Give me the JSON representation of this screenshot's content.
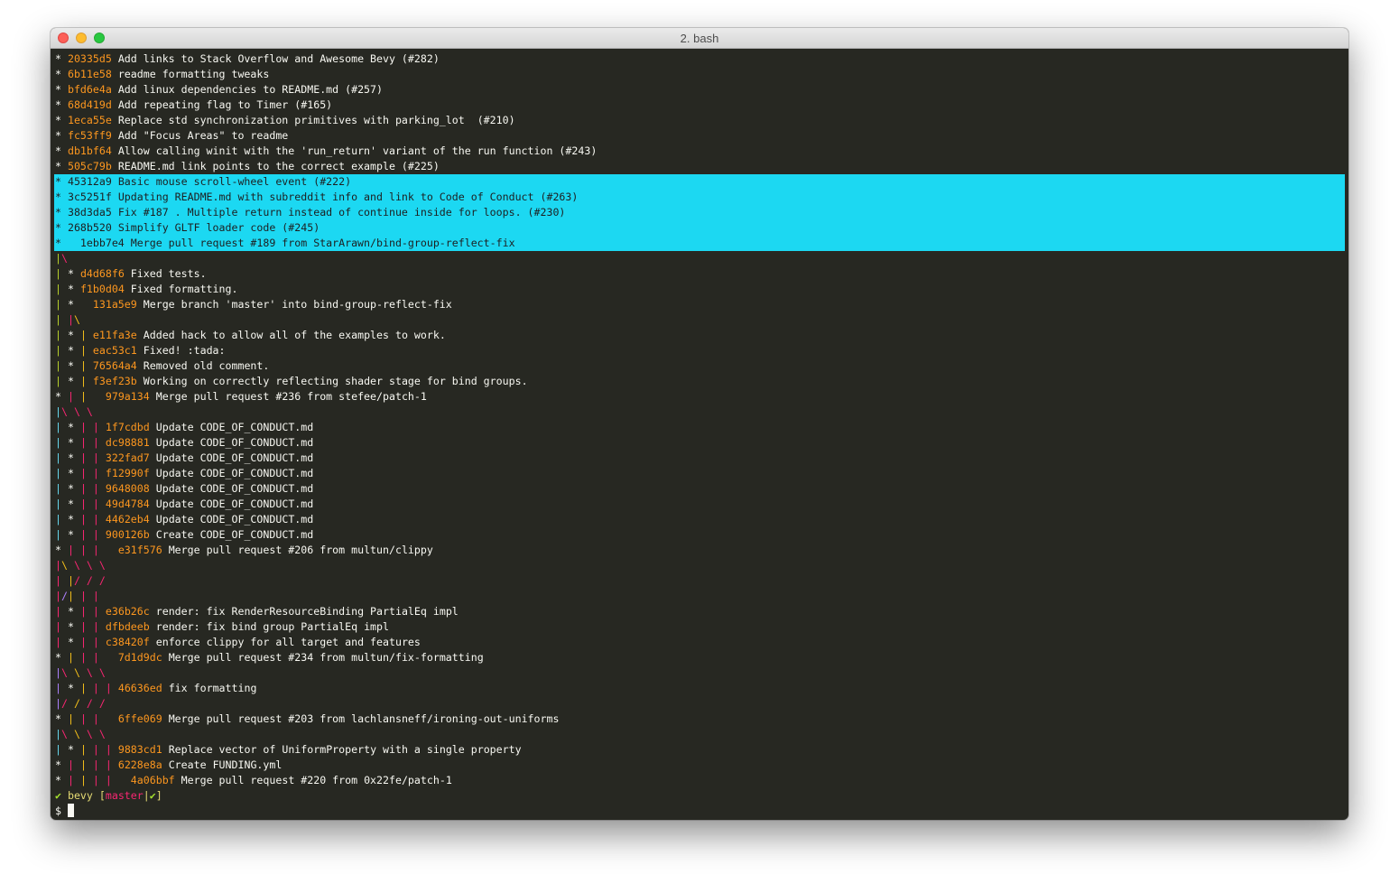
{
  "window": {
    "title": "2. bash"
  },
  "colors": {
    "background": "#272822",
    "selection": "#1cd8f2",
    "hash": "#fd971f",
    "graph_green": "#b8d12a",
    "graph_pink": "#f92672",
    "graph_yellow": "#f4bf1a",
    "graph_purple": "#ae81ff",
    "graph_cyan": "#66d9ef"
  },
  "log": [
    {
      "graph": [
        [
          "* ",
          ""
        ]
      ],
      "hash": "20335d5",
      "msg": "Add links to Stack Overflow and Awesome Bevy (#282)"
    },
    {
      "graph": [
        [
          "* ",
          ""
        ]
      ],
      "hash": "6b11e58",
      "msg": "readme formatting tweaks"
    },
    {
      "graph": [
        [
          "* ",
          ""
        ]
      ],
      "hash": "bfd6e4a",
      "msg": "Add linux dependencies to README.md (#257)"
    },
    {
      "graph": [
        [
          "* ",
          ""
        ]
      ],
      "hash": "68d419d",
      "msg": "Add repeating flag to Timer (#165)"
    },
    {
      "graph": [
        [
          "* ",
          ""
        ]
      ],
      "hash": "1eca55e",
      "msg": "Replace std synchronization primitives with parking_lot  (#210)"
    },
    {
      "graph": [
        [
          "* ",
          ""
        ]
      ],
      "hash": "fc53ff9",
      "msg": "Add \"Focus Areas\" to readme"
    },
    {
      "graph": [
        [
          "* ",
          ""
        ]
      ],
      "hash": "db1bf64",
      "msg": "Allow calling winit with the 'run_return' variant of the run function (#243)"
    },
    {
      "graph": [
        [
          "* ",
          ""
        ]
      ],
      "hash": "505c79b",
      "msg": "README.md link points to the correct example (#225)"
    },
    {
      "graph": [
        [
          "* ",
          ""
        ]
      ],
      "hash": "45312a9",
      "msg": "Basic mouse scroll-wheel event (#222)",
      "selected": true
    },
    {
      "graph": [
        [
          "* ",
          ""
        ]
      ],
      "hash": "3c5251f",
      "msg": "Updating README.md with subreddit info and link to Code of Conduct (#263)",
      "selected": true
    },
    {
      "graph": [
        [
          "* ",
          ""
        ]
      ],
      "hash": "38d3da5",
      "msg": "Fix #187 . Multiple return instead of continue inside for loops. (#230)",
      "selected": true
    },
    {
      "graph": [
        [
          "* ",
          ""
        ]
      ],
      "hash": "268b520",
      "msg": "Simplify GLTF loader code (#245)",
      "selected": true
    },
    {
      "graph": [
        [
          "*   ",
          ""
        ]
      ],
      "hash": "1ebb7e4",
      "msg": "Merge pull request #189 from StarArawn/bind-group-reflect-fix",
      "selected": true
    },
    {
      "graph": [
        [
          "|",
          "g1"
        ],
        [
          "\\",
          "g2"
        ]
      ],
      "hash": "",
      "msg": ""
    },
    {
      "graph": [
        [
          "| ",
          "g1"
        ],
        [
          "* ",
          ""
        ]
      ],
      "hash": "d4d68f6",
      "msg": "Fixed tests."
    },
    {
      "graph": [
        [
          "| ",
          "g1"
        ],
        [
          "* ",
          ""
        ]
      ],
      "hash": "f1b0d04",
      "msg": "Fixed formatting."
    },
    {
      "graph": [
        [
          "| ",
          "g1"
        ],
        [
          "*   ",
          ""
        ]
      ],
      "hash": "131a5e9",
      "msg": "Merge branch 'master' into bind-group-reflect-fix"
    },
    {
      "graph": [
        [
          "| ",
          "g1"
        ],
        [
          "|",
          "g2"
        ],
        [
          "\\",
          "g3"
        ]
      ],
      "hash": "",
      "msg": ""
    },
    {
      "graph": [
        [
          "| ",
          "g1"
        ],
        [
          "* ",
          ""
        ],
        [
          "| ",
          "g3"
        ]
      ],
      "hash": "e11fa3e",
      "msg": "Added hack to allow all of the examples to work."
    },
    {
      "graph": [
        [
          "| ",
          "g1"
        ],
        [
          "* ",
          ""
        ],
        [
          "| ",
          "g3"
        ]
      ],
      "hash": "eac53c1",
      "msg": "Fixed! :tada:"
    },
    {
      "graph": [
        [
          "| ",
          "g1"
        ],
        [
          "* ",
          ""
        ],
        [
          "| ",
          "g3"
        ]
      ],
      "hash": "76564a4",
      "msg": "Removed old comment."
    },
    {
      "graph": [
        [
          "| ",
          "g1"
        ],
        [
          "* ",
          ""
        ],
        [
          "| ",
          "g3"
        ]
      ],
      "hash": "f3ef23b",
      "msg": "Working on correctly reflecting shader stage for bind groups."
    },
    {
      "graph": [
        [
          "* ",
          ""
        ],
        [
          "| ",
          "g2"
        ],
        [
          "|   ",
          "g3"
        ]
      ],
      "hash": "979a134",
      "msg": "Merge pull request #236 from stefee/patch-1"
    },
    {
      "graph": [
        [
          "|",
          "g5"
        ],
        [
          "\\ ",
          "g2"
        ],
        [
          "\\ ",
          "g2"
        ],
        [
          "\\",
          "g2"
        ]
      ],
      "hash": "",
      "msg": ""
    },
    {
      "graph": [
        [
          "| ",
          "g5"
        ],
        [
          "* ",
          ""
        ],
        [
          "| ",
          "g2"
        ],
        [
          "| ",
          "g2"
        ]
      ],
      "hash": "1f7cdbd",
      "msg": "Update CODE_OF_CONDUCT.md"
    },
    {
      "graph": [
        [
          "| ",
          "g5"
        ],
        [
          "* ",
          ""
        ],
        [
          "| ",
          "g2"
        ],
        [
          "| ",
          "g2"
        ]
      ],
      "hash": "dc98881",
      "msg": "Update CODE_OF_CONDUCT.md"
    },
    {
      "graph": [
        [
          "| ",
          "g5"
        ],
        [
          "* ",
          ""
        ],
        [
          "| ",
          "g2"
        ],
        [
          "| ",
          "g2"
        ]
      ],
      "hash": "322fad7",
      "msg": "Update CODE_OF_CONDUCT.md"
    },
    {
      "graph": [
        [
          "| ",
          "g5"
        ],
        [
          "* ",
          ""
        ],
        [
          "| ",
          "g2"
        ],
        [
          "| ",
          "g2"
        ]
      ],
      "hash": "f12990f",
      "msg": "Update CODE_OF_CONDUCT.md"
    },
    {
      "graph": [
        [
          "| ",
          "g5"
        ],
        [
          "* ",
          ""
        ],
        [
          "| ",
          "g2"
        ],
        [
          "| ",
          "g2"
        ]
      ],
      "hash": "9648008",
      "msg": "Update CODE_OF_CONDUCT.md"
    },
    {
      "graph": [
        [
          "| ",
          "g5"
        ],
        [
          "* ",
          ""
        ],
        [
          "| ",
          "g2"
        ],
        [
          "| ",
          "g2"
        ]
      ],
      "hash": "49d4784",
      "msg": "Update CODE_OF_CONDUCT.md"
    },
    {
      "graph": [
        [
          "| ",
          "g5"
        ],
        [
          "* ",
          ""
        ],
        [
          "| ",
          "g2"
        ],
        [
          "| ",
          "g2"
        ]
      ],
      "hash": "4462eb4",
      "msg": "Update CODE_OF_CONDUCT.md"
    },
    {
      "graph": [
        [
          "| ",
          "g5"
        ],
        [
          "* ",
          ""
        ],
        [
          "| ",
          "g2"
        ],
        [
          "| ",
          "g2"
        ]
      ],
      "hash": "900126b",
      "msg": "Create CODE_OF_CONDUCT.md"
    },
    {
      "graph": [
        [
          "* ",
          ""
        ],
        [
          "| ",
          "g2"
        ],
        [
          "| ",
          "g2"
        ],
        [
          "|   ",
          "g2"
        ]
      ],
      "hash": "e31f576",
      "msg": "Merge pull request #206 from multun/clippy"
    },
    {
      "graph": [
        [
          "|",
          "g2"
        ],
        [
          "\\ ",
          "g3"
        ],
        [
          "\\ ",
          "g2"
        ],
        [
          "\\ ",
          "g2"
        ],
        [
          "\\",
          "g2"
        ]
      ],
      "hash": "",
      "msg": ""
    },
    {
      "graph": [
        [
          "| ",
          "g2"
        ],
        [
          "|",
          "g3"
        ],
        [
          "/ ",
          "g2"
        ],
        [
          "/ ",
          "g2"
        ],
        [
          "/",
          "g2"
        ]
      ],
      "hash": "",
      "msg": ""
    },
    {
      "graph": [
        [
          "|",
          "g2"
        ],
        [
          "/",
          "g4"
        ],
        [
          "| ",
          "g3"
        ],
        [
          "| ",
          "g2"
        ],
        [
          "|",
          "g2"
        ]
      ],
      "hash": "",
      "msg": ""
    },
    {
      "graph": [
        [
          "| ",
          "g2"
        ],
        [
          "* ",
          ""
        ],
        [
          "| ",
          "g2"
        ],
        [
          "| ",
          "g2"
        ]
      ],
      "hash": "e36b26c",
      "msg": "render: fix RenderResourceBinding PartialEq impl"
    },
    {
      "graph": [
        [
          "| ",
          "g2"
        ],
        [
          "* ",
          ""
        ],
        [
          "| ",
          "g2"
        ],
        [
          "| ",
          "g2"
        ]
      ],
      "hash": "dfbdeeb",
      "msg": "render: fix bind group PartialEq impl"
    },
    {
      "graph": [
        [
          "| ",
          "g2"
        ],
        [
          "* ",
          ""
        ],
        [
          "| ",
          "g2"
        ],
        [
          "| ",
          "g2"
        ]
      ],
      "hash": "c38420f",
      "msg": "enforce clippy for all target and features"
    },
    {
      "graph": [
        [
          "* ",
          ""
        ],
        [
          "| ",
          "g3"
        ],
        [
          "| ",
          "g2"
        ],
        [
          "|   ",
          "g2"
        ]
      ],
      "hash": "7d1d9dc",
      "msg": "Merge pull request #234 from multun/fix-formatting"
    },
    {
      "graph": [
        [
          "|",
          "g4"
        ],
        [
          "\\ ",
          "g2"
        ],
        [
          "\\ ",
          "g3"
        ],
        [
          "\\ ",
          "g2"
        ],
        [
          "\\",
          "g2"
        ]
      ],
      "hash": "",
      "msg": ""
    },
    {
      "graph": [
        [
          "| ",
          "g4"
        ],
        [
          "* ",
          ""
        ],
        [
          "| ",
          "g3"
        ],
        [
          "| ",
          "g2"
        ],
        [
          "| ",
          "g2"
        ]
      ],
      "hash": "46636ed",
      "msg": "fix formatting"
    },
    {
      "graph": [
        [
          "|",
          "g4"
        ],
        [
          "/ ",
          "g2"
        ],
        [
          "/ ",
          "g3"
        ],
        [
          "/ ",
          "g2"
        ],
        [
          "/",
          "g2"
        ]
      ],
      "hash": "",
      "msg": ""
    },
    {
      "graph": [
        [
          "* ",
          ""
        ],
        [
          "| ",
          "g3"
        ],
        [
          "| ",
          "g2"
        ],
        [
          "|   ",
          "g2"
        ]
      ],
      "hash": "6ffe069",
      "msg": "Merge pull request #203 from lachlansneff/ironing-out-uniforms"
    },
    {
      "graph": [
        [
          "|",
          "g5"
        ],
        [
          "\\ ",
          "g2"
        ],
        [
          "\\ ",
          "g3"
        ],
        [
          "\\ ",
          "g2"
        ],
        [
          "\\",
          "g2"
        ]
      ],
      "hash": "",
      "msg": ""
    },
    {
      "graph": [
        [
          "| ",
          "g5"
        ],
        [
          "* ",
          ""
        ],
        [
          "| ",
          "g3"
        ],
        [
          "| ",
          "g2"
        ],
        [
          "| ",
          "g2"
        ]
      ],
      "hash": "9883cd1",
      "msg": "Replace vector of UniformProperty with a single property"
    },
    {
      "graph": [
        [
          "* ",
          ""
        ],
        [
          "| ",
          "g2"
        ],
        [
          "| ",
          "g3"
        ],
        [
          "| ",
          "g2"
        ],
        [
          "| ",
          "g2"
        ]
      ],
      "hash": "6228e8a",
      "msg": "Create FUNDING.yml"
    },
    {
      "graph": [
        [
          "* ",
          ""
        ],
        [
          "| ",
          "g2"
        ],
        [
          "| ",
          "g3"
        ],
        [
          "| ",
          "g2"
        ],
        [
          "|   ",
          "g2"
        ]
      ],
      "hash": "4a06bbf",
      "msg": "Merge pull request #220 from 0x22fe/patch-1"
    }
  ],
  "prompt": {
    "check": "✔",
    "dir": "bevy",
    "open_bracket": "[",
    "branch": "master",
    "separator": "|",
    "status": "✔",
    "close_bracket": "]",
    "symbol": "$"
  }
}
